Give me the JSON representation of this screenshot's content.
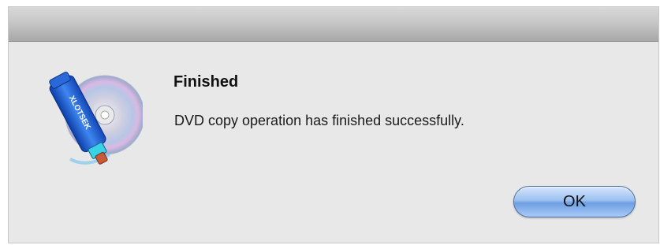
{
  "dialog": {
    "title": "Finished",
    "message": "DVD copy operation has finished successfully.",
    "ok_label": "OK",
    "icon": "dvd-copy-app-icon",
    "icon_text": "XLOTSEK"
  },
  "colors": {
    "background": "#e8e8e8",
    "button_accent": "#6e9fe3",
    "drive_blue": "#1f5fd0"
  }
}
